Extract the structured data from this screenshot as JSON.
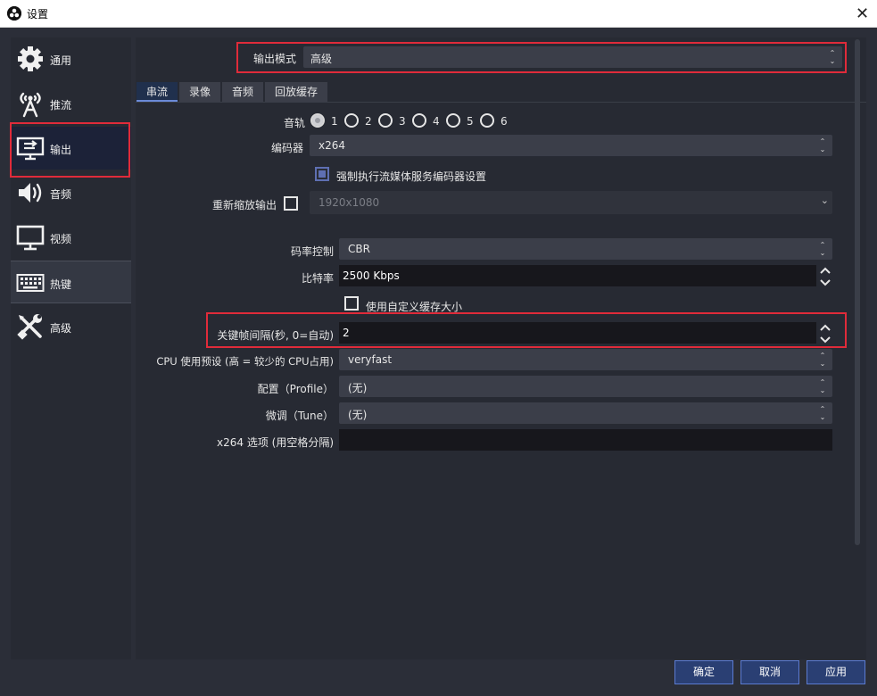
{
  "window": {
    "title": "设置",
    "close": "✕"
  },
  "sidebar": {
    "items": [
      {
        "label": "通用",
        "icon": "gear-icon"
      },
      {
        "label": "推流",
        "icon": "broadcast-antenna-icon"
      },
      {
        "label": "输出",
        "icon": "output-monitor-icon"
      },
      {
        "label": "音频",
        "icon": "speaker-icon"
      },
      {
        "label": "视频",
        "icon": "monitor-icon"
      },
      {
        "label": "热键",
        "icon": "keyboard-icon"
      },
      {
        "label": "高级",
        "icon": "tools-icon"
      }
    ],
    "active_index": 2,
    "highlight_index": 5
  },
  "output": {
    "mode_label": "输出模式",
    "mode_value": "高级",
    "tabs": [
      "串流",
      "录像",
      "音频",
      "回放缓存"
    ],
    "active_tab": 0,
    "track_label": "音轨",
    "tracks": [
      "1",
      "2",
      "3",
      "4",
      "5",
      "6"
    ],
    "selected_track": "1",
    "encoder_label": "编码器",
    "encoder_value": "x264",
    "enforce_label": "强制执行流媒体服务编码器设置",
    "enforce_checked": true,
    "rescale_label": "重新缩放输出",
    "rescale_checked": false,
    "rescale_value": "1920x1080",
    "rate_control_label": "码率控制",
    "rate_control_value": "CBR",
    "bitrate_label": "比特率",
    "bitrate_value": "2500 Kbps",
    "custom_buffer_label": "使用自定义缓存大小",
    "custom_buffer_checked": false,
    "keyframe_label": "关键帧间隔(秒, 0=自动)",
    "keyframe_value": "2",
    "cpu_preset_label": "CPU 使用预设 (高 = 较少的 CPU占用)",
    "cpu_preset_value": "veryfast",
    "profile_label": "配置（Profile）",
    "profile_value": "(无)",
    "tune_label": "微调（Tune）",
    "tune_value": "(无)",
    "x264_opts_label": "x264 选项 (用空格分隔)",
    "x264_opts_value": ""
  },
  "buttons": {
    "ok": "确定",
    "cancel": "取消",
    "apply": "应用"
  },
  "colors": {
    "highlight_box": "#e02b3a",
    "accent": "#2a3f73",
    "background": "#272a33"
  }
}
